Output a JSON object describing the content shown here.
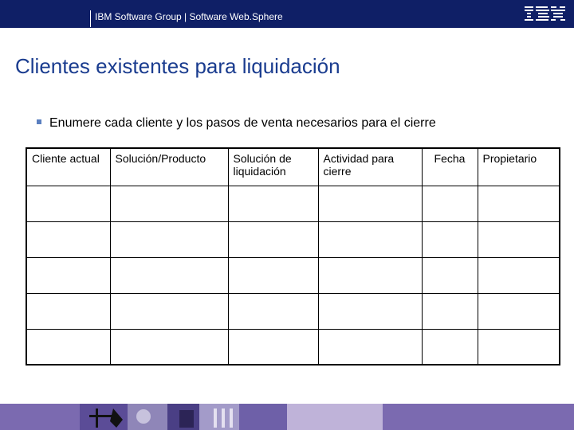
{
  "header": {
    "text": "IBM Software Group | Software Web.Sphere",
    "logo_text": "IBM",
    "background": "#0f1f66"
  },
  "title": "Clientes existentes para liquidación",
  "bullet": "Enumere cada cliente y los pasos de venta necesarios para el cierre",
  "table": {
    "columns": [
      "Cliente actual",
      "Solución/Producto",
      "Solución de liquidación",
      "Actividad para cierre",
      "Fecha",
      "Propietario"
    ],
    "rows": [
      [
        "",
        "",
        "",
        "",
        "",
        ""
      ],
      [
        "",
        "",
        "",
        "",
        "",
        ""
      ],
      [
        "",
        "",
        "",
        "",
        "",
        ""
      ],
      [
        "",
        "",
        "",
        "",
        "",
        ""
      ],
      [
        "",
        "",
        "",
        "",
        "",
        ""
      ]
    ]
  },
  "colors": {
    "title": "#1a3c8f",
    "bullet": "#5a7fc0",
    "footer": "#7b6ab0"
  }
}
